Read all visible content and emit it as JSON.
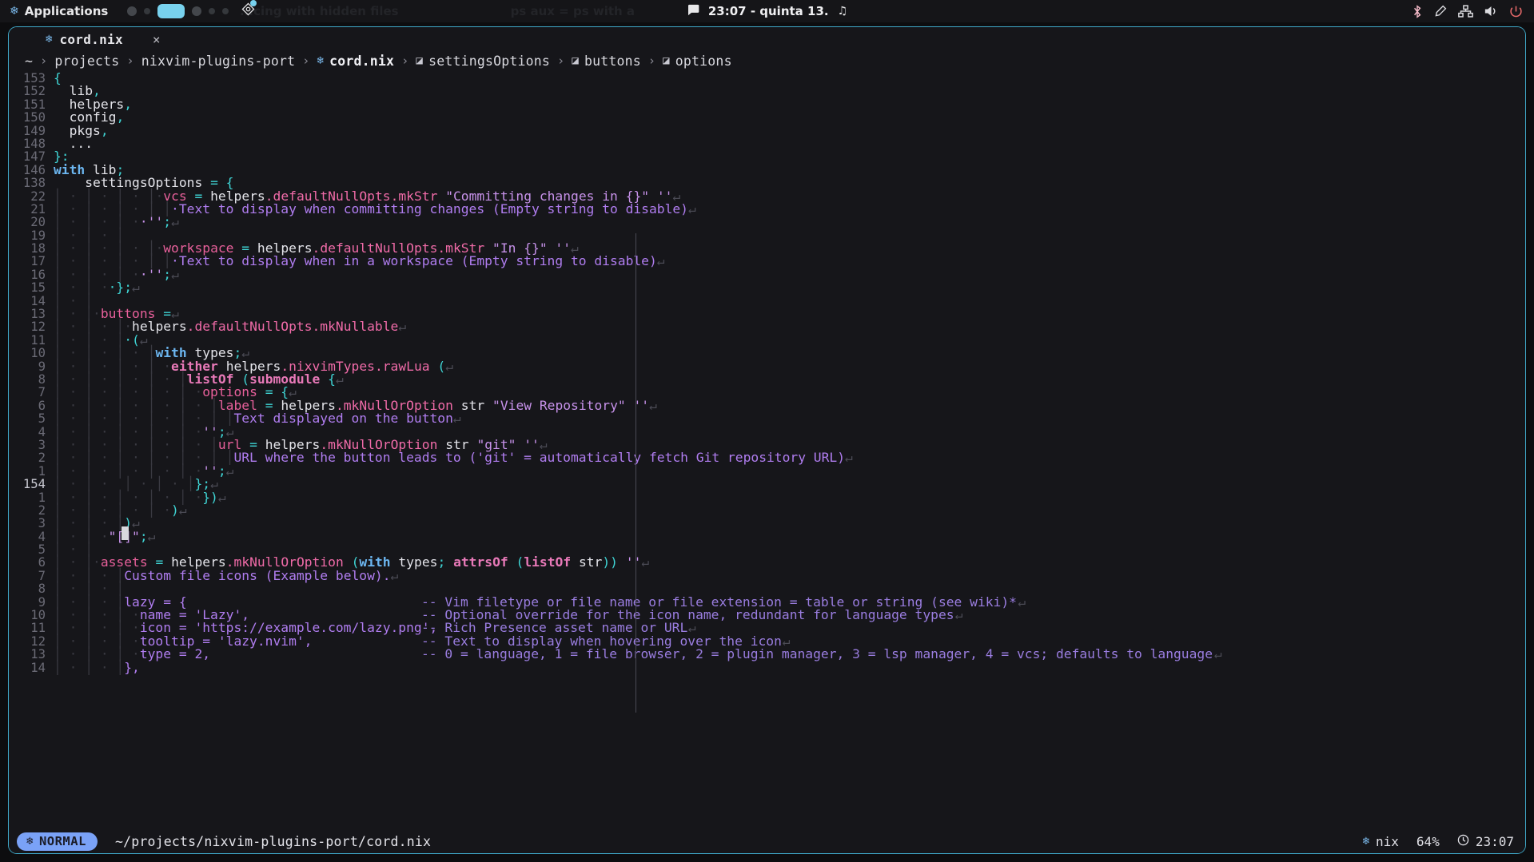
{
  "topbar": {
    "applications_label": "Applications",
    "applications_icon": "nix-snowflake-icon",
    "layout_icon": "layout-diamond-icon",
    "background_hint_1": "...cing with hidden files",
    "background_hint_2": "ps aux = ps with a",
    "clock": "23:07 - quinta 13.",
    "chat_icon": "speech-bubble-icon",
    "music_icon": "music-note-icon",
    "tray": {
      "bluetooth_icon": "bluetooth-icon",
      "brightness_icon": "brightness-pen-icon",
      "network_icon": "network-icon",
      "volume_icon": "volume-icon",
      "power_icon": "power-icon"
    },
    "workspaces": [
      {
        "state": "inactive",
        "size": "md"
      },
      {
        "state": "inactive",
        "size": "sm"
      },
      {
        "state": "active",
        "size": "lg"
      },
      {
        "state": "inactive",
        "size": "md"
      },
      {
        "state": "inactive",
        "size": "sm"
      },
      {
        "state": "inactive",
        "size": "sm"
      }
    ]
  },
  "tab": {
    "icon": "nix-snowflake-icon",
    "name": "cord.nix",
    "close_label": "×"
  },
  "breadcrumb": {
    "separator": "›",
    "items": [
      {
        "label": "~",
        "icon": null
      },
      {
        "label": "projects",
        "icon": null
      },
      {
        "label": "nixvim-plugins-port",
        "icon": null
      },
      {
        "label": "cord.nix",
        "icon": "nix-snowflake-icon",
        "kind": "file"
      },
      {
        "label": "settingsOptions",
        "icon": "module-hex-icon"
      },
      {
        "label": "buttons",
        "icon": "module-hex-icon"
      },
      {
        "label": "options",
        "icon": "module-hex-icon"
      }
    ]
  },
  "editor": {
    "cursor_line_number": "154",
    "eol_glyph": "↵",
    "indent_dot": "·",
    "indent_bar": "│",
    "lines": [
      {
        "num": "153",
        "indent": "",
        "html": "<span class='punc'>{</span>"
      },
      {
        "num": "152",
        "indent": "",
        "html": "  <span class='ident'>lib</span><span class='punc'>,</span>"
      },
      {
        "num": "151",
        "indent": "",
        "html": "  <span class='ident'>helpers</span><span class='punc'>,</span>"
      },
      {
        "num": "150",
        "indent": "",
        "html": "  <span class='ident'>config</span><span class='punc'>,</span>"
      },
      {
        "num": "149",
        "indent": "",
        "html": "  <span class='ident'>pkgs</span><span class='punc'>,</span>"
      },
      {
        "num": "148",
        "indent": "",
        "html": "  <span class='ident'>...</span>"
      },
      {
        "num": "147",
        "indent": "",
        "html": "<span class='punc'>}:</span>"
      },
      {
        "num": "146",
        "indent": "",
        "html": "<span class='kw'>with</span> <span class='ident'>lib</span><span class='punc'>;</span>"
      },
      {
        "num": "138",
        "indent": "",
        "html": "    <span class='ident'>settingsOptions</span> <span class='punc'>= {</span>"
      },
      {
        "num": "22",
        "indent": "",
        "html": "<span class='ig'>│ · │ · │ · │</span><span class='ig'>·</span><span class='attr'>vcs</span> <span class='punc'>=</span> <span class='ident'>helpers</span><span class='fn'>.defaultNullOpts.mkStr</span> <span class='str'>\"Committing changes in {}\" ''</span><span class='eol'>↵</span>"
      },
      {
        "num": "21",
        "indent": "",
        "html": "<span class='ig'>│ · │ · │ · │ │</span><span class='doc'>·Text to display when committing changes (Empty string to disable)</span><span class='eol'>↵</span>"
      },
      {
        "num": "20",
        "indent": "",
        "html": "<span class='ig'>│ · │ · │ ·</span><span class='str'>·''</span><span class='punc'>;</span><span class='eol'>↵</span>"
      },
      {
        "num": "19",
        "indent": "",
        "html": "<span class='ig'>│ · │ · │</span>"
      },
      {
        "num": "18",
        "indent": "",
        "html": "<span class='ig'>│ · │ · │ · │</span><span class='ig'>·</span><span class='attr'>workspace</span> <span class='punc'>=</span> <span class='ident'>helpers</span><span class='fn'>.defaultNullOpts.mkStr</span> <span class='str'>\"In {}\" ''</span><span class='eol'>↵</span>"
      },
      {
        "num": "17",
        "indent": "",
        "html": "<span class='ig'>│ · │ · │ · │ │</span><span class='doc'>·Text to display when in a workspace (Empty string to disable)</span><span class='eol'>↵</span>"
      },
      {
        "num": "16",
        "indent": "",
        "html": "<span class='ig'>│ · │ · │ ·</span><span class='str'>·''</span><span class='punc'>;</span><span class='eol'>↵</span>"
      },
      {
        "num": "15",
        "indent": "",
        "html": "<span class='ig'>│ · │ ·</span><span class='punc'>·};</span><span class='eol'>↵</span>"
      },
      {
        "num": "14",
        "indent": "",
        "html": "<span class='ig'>│ · │</span>"
      },
      {
        "num": "13",
        "indent": "",
        "html": "<span class='ig'>│ · │</span><span class='ig'>·</span><span class='attr'>buttons</span> <span class='punc'>=</span><span class='eol'>↵</span>"
      },
      {
        "num": "12",
        "indent": "",
        "html": "<span class='ig'>│ · │ · │</span><span class='ig'>·</span><span class='ident'>helpers</span><span class='fn'>.defaultNullOpts.mkNullable</span><span class='eol'>↵</span>"
      },
      {
        "num": "11",
        "indent": "",
        "html": "<span class='ig'>│ · │ · │</span><span class='punc'>·(</span><span class='eol'>↵</span>"
      },
      {
        "num": "10",
        "indent": "",
        "html": "<span class='ig'>│ · │ · │ · │</span><span class='kw'>with</span> <span class='ident'>types</span><span class='punc'>;</span><span class='eol'>↵</span>"
      },
      {
        "num": "9",
        "indent": "",
        "html": "<span class='ig'>│ · │ · │ · │ ·</span><span class='kw2'>either</span> <span class='ident'>helpers</span><span class='fn'>.nixvimTypes.rawLua</span> <span class='punc'>(</span><span class='eol'>↵</span>"
      },
      {
        "num": "8",
        "indent": "",
        "html": "<span class='ig'>│ · │ · │ · │ · │</span><span class='kw2'>listOf</span> <span class='punc'>(</span><span class='kw2'>submodule</span> <span class='punc'>{</span><span class='eol'>↵</span>"
      },
      {
        "num": "7",
        "indent": "",
        "html": "<span class='ig'>│ · │ · │ · │ · │ ·</span><span class='attr'>options</span> <span class='punc'>= {</span><span class='eol'>↵</span>"
      },
      {
        "num": "6",
        "indent": "",
        "html": "<span class='ig'>│ · │ · │ · │ · │ · │</span><span class='attr'>label</span> <span class='punc'>=</span> <span class='ident'>helpers</span><span class='fn'>.mkNullOrOption</span> <span class='ident'>str</span> <span class='str'>\"View Repository\" ''</span><span class='eol'>↵</span>"
      },
      {
        "num": "5",
        "indent": "",
        "html": "<span class='ig'>│ · │ · │ · │ · │ · │ │</span><span class='doc'>Text displayed on the button</span><span class='eol'>↵</span>"
      },
      {
        "num": "4",
        "indent": "",
        "html": "<span class='ig'>│ · │ · │ · │ · │ ·</span><span class='str'>''</span><span class='punc'>;</span><span class='eol'>↵</span>"
      },
      {
        "num": "3",
        "indent": "",
        "html": "<span class='ig'>│ · │ · │ · │ · │ · │</span><span class='attr'>url</span> <span class='punc'>=</span> <span class='ident'>helpers</span><span class='fn'>.mkNullOrOption</span> <span class='ident'>str</span> <span class='str'>\"git\" ''</span><span class='eol'>↵</span>"
      },
      {
        "num": "2",
        "indent": "",
        "html": "<span class='ig'>│ · │ · │ · │ · │ · │ │</span><span class='doc'>URL where the button leads to ('git' = automatically fetch Git repository URL)</span><span class='eol'>↵</span>"
      },
      {
        "num": "1",
        "indent": "",
        "html": "<span class='ig'>│ · │ · │ · │ · │ ·</span><span class='str'>''</span><span class='punc'>;</span><span class='eol'>↵</span>"
      },
      {
        "num": "154",
        "cur": true,
        "indent": "",
        "html": "<span class='ig'>│ · │ ·</span><span class='ig'>  </span><span class='ig'>│ · │ · │</span><span class='punc'>};</span><span class='eol'>↵</span>"
      },
      {
        "num": "1",
        "indent": "",
        "html": "<span class='ig'>│ · │ · │ · │ · │ ·</span><span class='punc'>})</span><span class='eol'>↵</span>"
      },
      {
        "num": "2",
        "indent": "",
        "html": "<span class='ig'>│ · │ · │ · │ ·</span><span class='punc'>)</span><span class='eol'>↵</span>"
      },
      {
        "num": "3",
        "indent": "",
        "html": "<span class='ig'>│ · │ · │</span><span class='punc'>)</span><span class='eol'>↵</span>"
      },
      {
        "num": "4",
        "indent": "",
        "html": "<span class='ig'>│ · │ ·</span><span class='str'>\"[]\"</span><span class='punc'>;</span><span class='eol'>↵</span>"
      },
      {
        "num": "5",
        "indent": "",
        "html": "<span class='ig'>│ · │</span>"
      },
      {
        "num": "6",
        "indent": "",
        "html": "<span class='ig'>│ · │</span><span class='ig'>·</span><span class='attr'>assets</span> <span class='punc'>=</span> <span class='ident'>helpers</span><span class='fn'>.mkNullOrOption</span> <span class='punc'>(</span><span class='kw'>with</span> <span class='ident'>types</span><span class='punc'>;</span> <span class='kw2'>attrsOf</span> <span class='punc'>(</span><span class='kw2'>listOf</span> <span class='ident'>str</span><span class='punc'>))</span> <span class='str'>''</span><span class='eol'>↵</span>"
      },
      {
        "num": "7",
        "indent": "",
        "html": "<span class='ig'>│ · │ · │</span><span class='doc'>Custom file icons (Example below).</span><span class='eol'>↵</span>"
      },
      {
        "num": "8",
        "indent": "",
        "html": "<span class='ig'>│ · │ · │</span>"
      },
      {
        "num": "9",
        "indent": "",
        "html": "<span class='ig'>│ · │ · │</span><span class='doc'>lazy = {</span>",
        "comment": "-- Vim filetype or file name or file extension = table or string (see wiki)*",
        "comment_col": 64,
        "eol": true
      },
      {
        "num": "10",
        "indent": "",
        "html": "<span class='ig'>│ · │ · │ ·</span><span class='doc'>name = 'Lazy',</span>",
        "comment": "-- Optional override for the icon name, redundant for language types",
        "comment_col": 64,
        "eol": true
      },
      {
        "num": "11",
        "indent": "",
        "html": "<span class='ig'>│ · │ · │ ·</span><span class='doc'>icon = 'https://example.com/lazy.png',</span>",
        "comment": "-- Rich Presence asset name or URL",
        "comment_col": 64,
        "eol": true
      },
      {
        "num": "12",
        "indent": "",
        "html": "<span class='ig'>│ · │ · │ ·</span><span class='doc'>tooltip = 'lazy.nvim',</span>",
        "comment": "-- Text to display when hovering over the icon",
        "comment_col": 64,
        "eol": true
      },
      {
        "num": "13",
        "indent": "",
        "html": "<span class='ig'>│ · │ · │ ·</span><span class='doc'>type = 2,</span>",
        "comment": "-- 0 = language, 1 = file browser, 2 = plugin manager, 3 = lsp manager, 4 = vcs; defaults to language",
        "comment_col": 64,
        "eol": true
      },
      {
        "num": "14",
        "indent": "",
        "html": "<span class='ig'>│ · │ · │</span><span class='doc'>},</span>"
      }
    ]
  },
  "statusline": {
    "mode": "NORMAL",
    "mode_icon": "nix-snowflake-icon",
    "filepath": "~/projects/nixvim-plugins-port/cord.nix",
    "filetype_icon": "nix-snowflake-icon",
    "filetype": "nix",
    "progress": "64%",
    "clock_icon": "clock-icon",
    "clock": "23:07"
  },
  "colors": {
    "accent_border": "#3fa9c9",
    "mode_badge_bg": "#7aa2f7",
    "workspace_active": "#78d2ee",
    "comment": "#9a7de0",
    "string": "#c792ea",
    "attribute": "#e8609b",
    "punctuation": "#3fd5d5",
    "keyword": "#6cb6f0"
  }
}
